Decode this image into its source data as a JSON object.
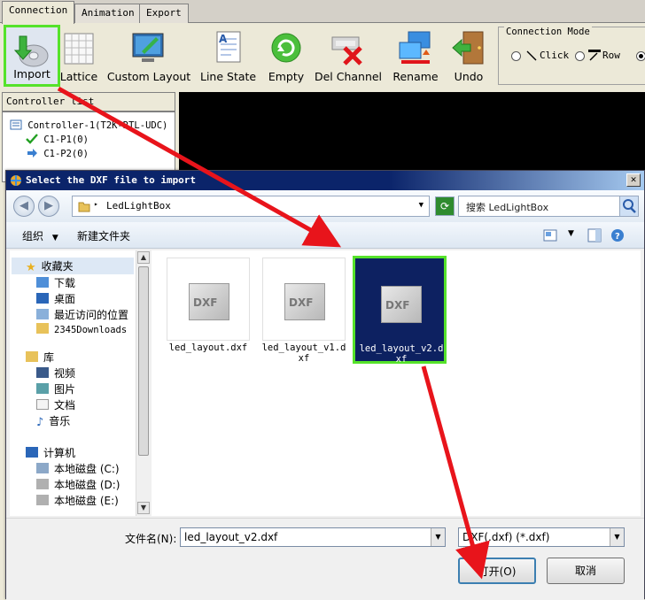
{
  "tabs": [
    {
      "label": "Connection",
      "active": true
    },
    {
      "label": "Animation",
      "active": false
    },
    {
      "label": "Export",
      "active": false
    }
  ],
  "toolbar": {
    "import": "Import",
    "lattice": "Lattice",
    "custom_layout": "Custom Layout",
    "line_state": "Line State",
    "empty": "Empty",
    "del_channel": "Del Channel",
    "rename": "Rename",
    "undo": "Undo"
  },
  "connection_mode": {
    "legend": "Connection Mode",
    "click": "Click",
    "row": "Row"
  },
  "controller_list": {
    "title": "Controller list",
    "controller": "Controller-1(T2K-RTL-UDC)",
    "port1": "C1-P1(0)",
    "port2": "C1-P2(0)"
  },
  "dialog": {
    "title": "Select the DXF file to import",
    "path": "LedLightBox",
    "search_placeholder": "搜索 LedLightBox",
    "organize": "组织",
    "new_folder": "新建文件夹",
    "nav": {
      "favorites": "收藏夹",
      "downloads": "下载",
      "desktop": "桌面",
      "recent": "最近访问的位置",
      "downloads2345": "2345Downloads",
      "libraries": "库",
      "videos": "视频",
      "pictures": "图片",
      "documents": "文档",
      "music": "音乐",
      "computer": "计算机",
      "disk_c": "本地磁盘 (C:)",
      "disk_d": "本地磁盘 (D:)",
      "disk_e": "本地磁盘 (E:)"
    },
    "files": [
      {
        "name": "led_layout.dxf",
        "icon_text": "DXF"
      },
      {
        "name": "led_layout_v1.dxf",
        "icon_text": "DXF"
      },
      {
        "name": "led_layout_v2.dxf",
        "icon_text": "DXF"
      }
    ],
    "filename_label": "文件名(N):",
    "filename_value": "led_layout_v2.dxf",
    "filetype_value": "DXF(.dxf) (*.dxf)",
    "open_button": "打开(O)",
    "cancel_button": "取消"
  },
  "colors": {
    "highlight_green": "#55e22a",
    "selection_blue": "#0d2161",
    "arrow_red": "#e8141b"
  }
}
